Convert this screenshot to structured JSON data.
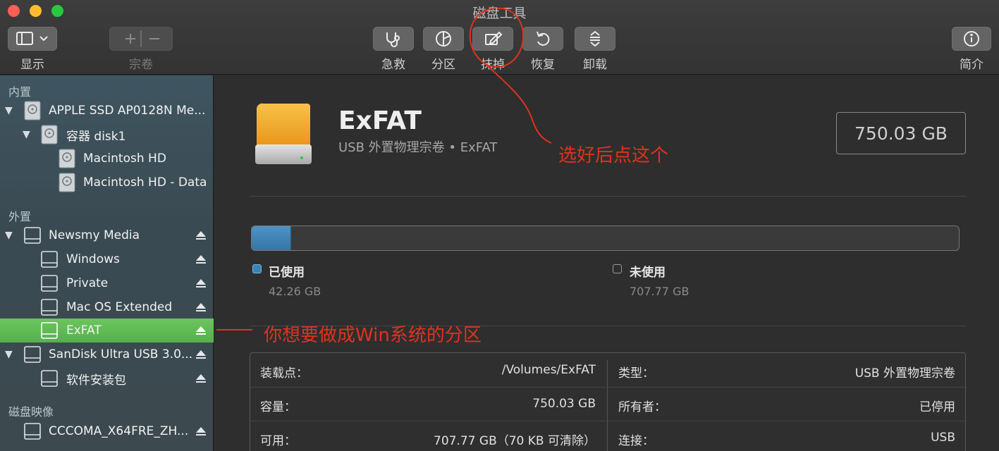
{
  "window": {
    "title": "磁盘工具"
  },
  "toolbar": {
    "view_label": "显示",
    "volume_label": "宗卷",
    "firstaid_label": "急救",
    "partition_label": "分区",
    "erase_label": "抹掉",
    "restore_label": "恢复",
    "unmount_label": "卸载",
    "info_label": "简介"
  },
  "sidebar": {
    "internal_header": "内置",
    "external_header": "外置",
    "images_header": "磁盘映像",
    "internal": [
      {
        "label": "APPLE SSD AP0128N Me..."
      },
      {
        "label": "容器 disk1"
      },
      {
        "label": "Macintosh HD"
      },
      {
        "label": "Macintosh HD - Data"
      }
    ],
    "external": [
      {
        "label": "Newsmy Media"
      },
      {
        "label": "Windows"
      },
      {
        "label": "Private"
      },
      {
        "label": "Mac OS Extended"
      },
      {
        "label": "ExFAT"
      },
      {
        "label": "SanDisk Ultra USB 3.0..."
      },
      {
        "label": "软件安装包"
      }
    ],
    "images": [
      {
        "label": "CCCOMA_X64FRE_ZH..."
      }
    ]
  },
  "volume": {
    "name": "ExFAT",
    "subtitle": "USB 外置物理宗卷 • ExFAT",
    "capacity": "750.03 GB"
  },
  "usage": {
    "used_fraction": 0.0563,
    "used_label": "已使用",
    "used_value": "42.26 GB",
    "free_label": "未使用",
    "free_value": "707.77 GB",
    "used_color": "#3b82b5"
  },
  "info": {
    "mount_key": "装载点：",
    "mount_val": "/Volumes/ExFAT",
    "capacity_key": "容量：",
    "capacity_val": "750.03 GB",
    "available_key": "可用：",
    "available_val": "707.77 GB（70 KB 可清除）",
    "type_key": "类型：",
    "type_val": "USB 外置物理宗卷",
    "owners_key": "所有者：",
    "owners_val": "已停用",
    "connection_key": "连接：",
    "connection_val": "USB"
  },
  "annotations": {
    "erase_note": "选好后点这个",
    "partition_note": "你想要做成Win系统的分区",
    "color": "#e0321e"
  }
}
